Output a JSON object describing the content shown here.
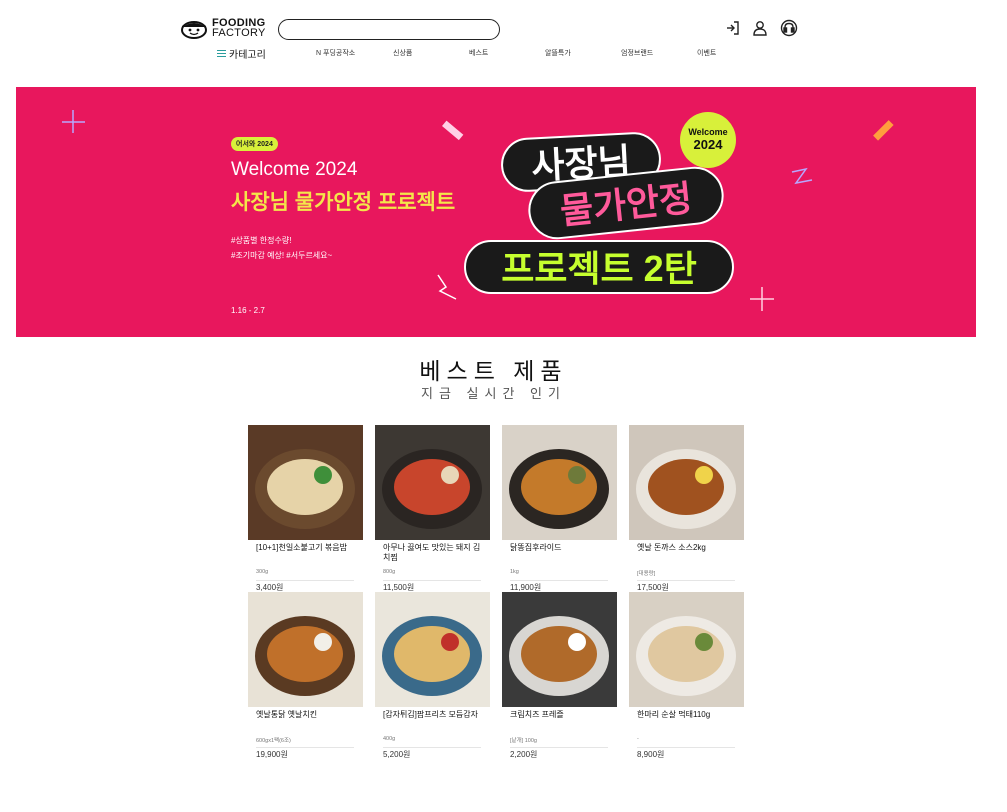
{
  "header": {
    "logo_line1": "FOODING",
    "logo_line2": "FACTORY",
    "search_placeholder": "",
    "icons": [
      "login-icon",
      "user-icon",
      "headset-icon"
    ]
  },
  "nav": {
    "category_label": "카테고리",
    "items": [
      "N 푸딩공작소",
      "신상품",
      "베스트",
      "알뜰특가",
      "엄정브랜드",
      "이벤트"
    ]
  },
  "banner": {
    "tag": "어서와 2024",
    "title": "Welcome 2024",
    "subtitle": "사장님 물가안정 프로젝트",
    "hashtag1": "#상품별 한정수량!",
    "hashtag2": "#조기마감 예상! #서두르세요~",
    "date": "1.16 - 2.7",
    "pill1": "사장님",
    "pill2": "물가안정",
    "pill3": "프로젝트 2탄",
    "badge_line1": "Welcome",
    "badge_line2": "2024",
    "colors": {
      "background": "#e8175d",
      "accent": "#d8f03a"
    }
  },
  "best": {
    "title": "베스트 제품",
    "subtitle": "지금 실시간 인기"
  },
  "products": [
    {
      "name": "[10+1]천일소불고기 볶음밥",
      "weight": "300g",
      "price": "3,400원"
    },
    {
      "name": "아무나 끓여도 맛있는 돼지 김치찜",
      "weight": "800g",
      "price": "11,500원"
    },
    {
      "name": "닭똥집후라이드",
      "weight": "1kg",
      "price": "11,900원"
    },
    {
      "name": "옛날 돈까스 소스2kg",
      "weight": "[대용량]",
      "price": "17,500원"
    },
    {
      "name": "옛날통닭 옛날치킨",
      "weight": "600gx1팩(6조)",
      "price": "19,900원"
    },
    {
      "name": "[감자튀김]팜프리츠 모듬감자",
      "weight": "400g",
      "price": "5,200원"
    },
    {
      "name": "크림치즈 프레즐",
      "weight": "[낱개] 100g",
      "price": "2,200원"
    },
    {
      "name": "한마리 순살 먹태110g",
      "weight": "-",
      "price": "8,900원"
    }
  ]
}
